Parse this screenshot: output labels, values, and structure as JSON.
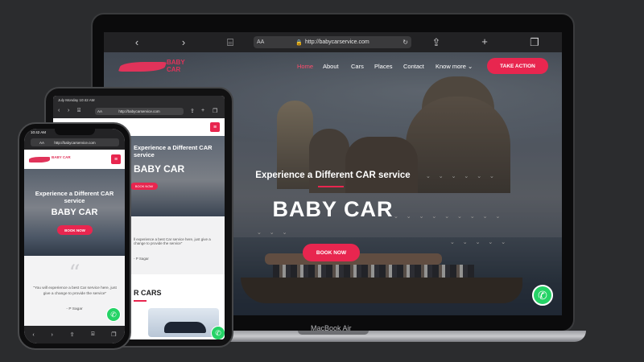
{
  "laptop": {
    "url": "http://babycarservice.com",
    "url_prefix": "AA",
    "brand_label": "MacBook Air",
    "logo_text": "BABY CAR",
    "nav": [
      "Home",
      "About",
      "Cars",
      "Places",
      "Contact",
      "Know more"
    ],
    "cta": "TAKE ACTION",
    "hero_subtitle": "Experience a Different CAR service",
    "hero_title": "BABY CAR",
    "hero_button": "BOOK NOW"
  },
  "tablet": {
    "status": "July Monday 10:42 AM",
    "url": "http://babycarservice.com",
    "url_prefix": "AA",
    "hero_subtitle": "Experience a Different CAR service",
    "hero_title": "BABY CAR",
    "hero_button": "BOOK NOW",
    "quote": "ll experience a best Car service here, just give a change to provide the service\"",
    "author": "- P Sagar",
    "cars_title": "R CARS"
  },
  "phone": {
    "status_time": "10:42 AM",
    "url": "http://babycarservice.com",
    "url_prefix": "AA",
    "logo_text": "BABY CAR",
    "hero_subtitle": "Experience a Different CAR service",
    "hero_title": "BABY CAR",
    "hero_button": "BOOK NOW",
    "quote": "\"You will experience a best Car service here, just give a change to provide the service\"",
    "author": "- P Sagar"
  },
  "icons": {
    "whatsapp": "whatsapp-icon",
    "back": "chevron-left-icon",
    "forward": "chevron-right-icon",
    "book": "book-icon",
    "share": "share-icon",
    "new_tab": "plus-icon",
    "tabs": "tabs-icon",
    "menu": "hamburger-icon"
  },
  "colors": {
    "accent": "#e8264f",
    "brand": "#e0335a",
    "whatsapp": "#25d366"
  }
}
